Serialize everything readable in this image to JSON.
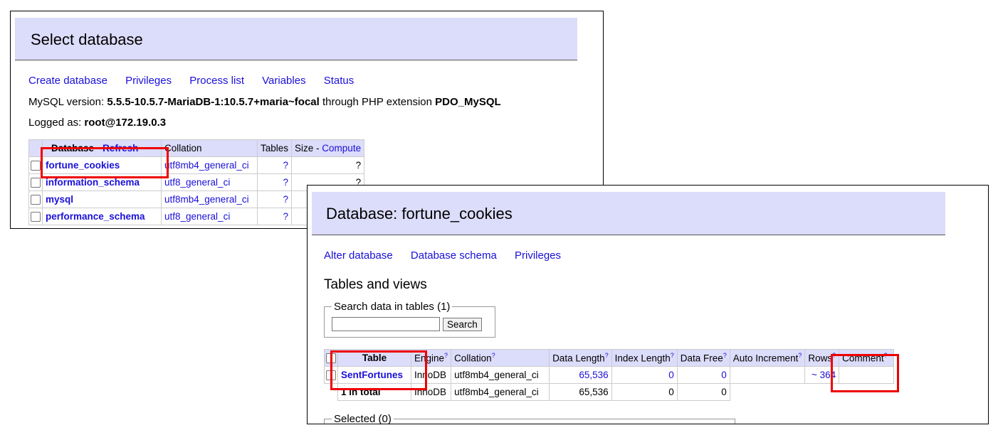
{
  "panel1": {
    "title": "Select database",
    "nav": [
      "Create database",
      "Privileges",
      "Process list",
      "Variables",
      "Status"
    ],
    "version_prefix": "MySQL version: ",
    "version": "5.5.5-10.5.7-MariaDB-1:10.5.7+maria~focal",
    "version_mid": " through PHP extension ",
    "extension": "PDO_MySQL",
    "logged_prefix": "Logged as: ",
    "logged_user": "root@172.19.0.3",
    "table": {
      "h_database": "Database",
      "h_refresh": "Refresh",
      "h_collation": "Collation",
      "h_tables": "Tables",
      "h_size": "Size - ",
      "h_compute": "Compute",
      "rows": [
        {
          "name": "fortune_cookies",
          "collation": "utf8mb4_general_ci",
          "tables": "?",
          "size": "?"
        },
        {
          "name": "information_schema",
          "collation": "utf8_general_ci",
          "tables": "?",
          "size": "?"
        },
        {
          "name": "mysql",
          "collation": "utf8mb4_general_ci",
          "tables": "?",
          "size": ""
        },
        {
          "name": "performance_schema",
          "collation": "utf8_general_ci",
          "tables": "?",
          "size": ""
        }
      ]
    }
  },
  "panel2": {
    "title": "Database: fortune_cookies",
    "nav": [
      "Alter database",
      "Database schema",
      "Privileges"
    ],
    "section_title": "Tables and views",
    "search_legend": "Search data in tables (1)",
    "search_button": "Search",
    "table": {
      "headers": [
        "Table",
        "Engine",
        "Collation",
        "Data Length",
        "Index Length",
        "Data Free",
        "Auto Increment",
        "Rows",
        "Comment"
      ],
      "help_mark": "?",
      "row": {
        "name": "SentFortunes",
        "engine": "InnoDB",
        "collation": "utf8mb4_general_ci",
        "data_length": "65,536",
        "index_length": "0",
        "data_free": "0",
        "auto_increment": "",
        "rows": "~ 364",
        "comment": ""
      },
      "total": {
        "label": "1 in total",
        "engine": "InnoDB",
        "collation": "utf8mb4_general_ci",
        "data_length": "65,536",
        "index_length": "0",
        "data_free": "0"
      }
    },
    "selected_legend": "Selected (0)"
  }
}
